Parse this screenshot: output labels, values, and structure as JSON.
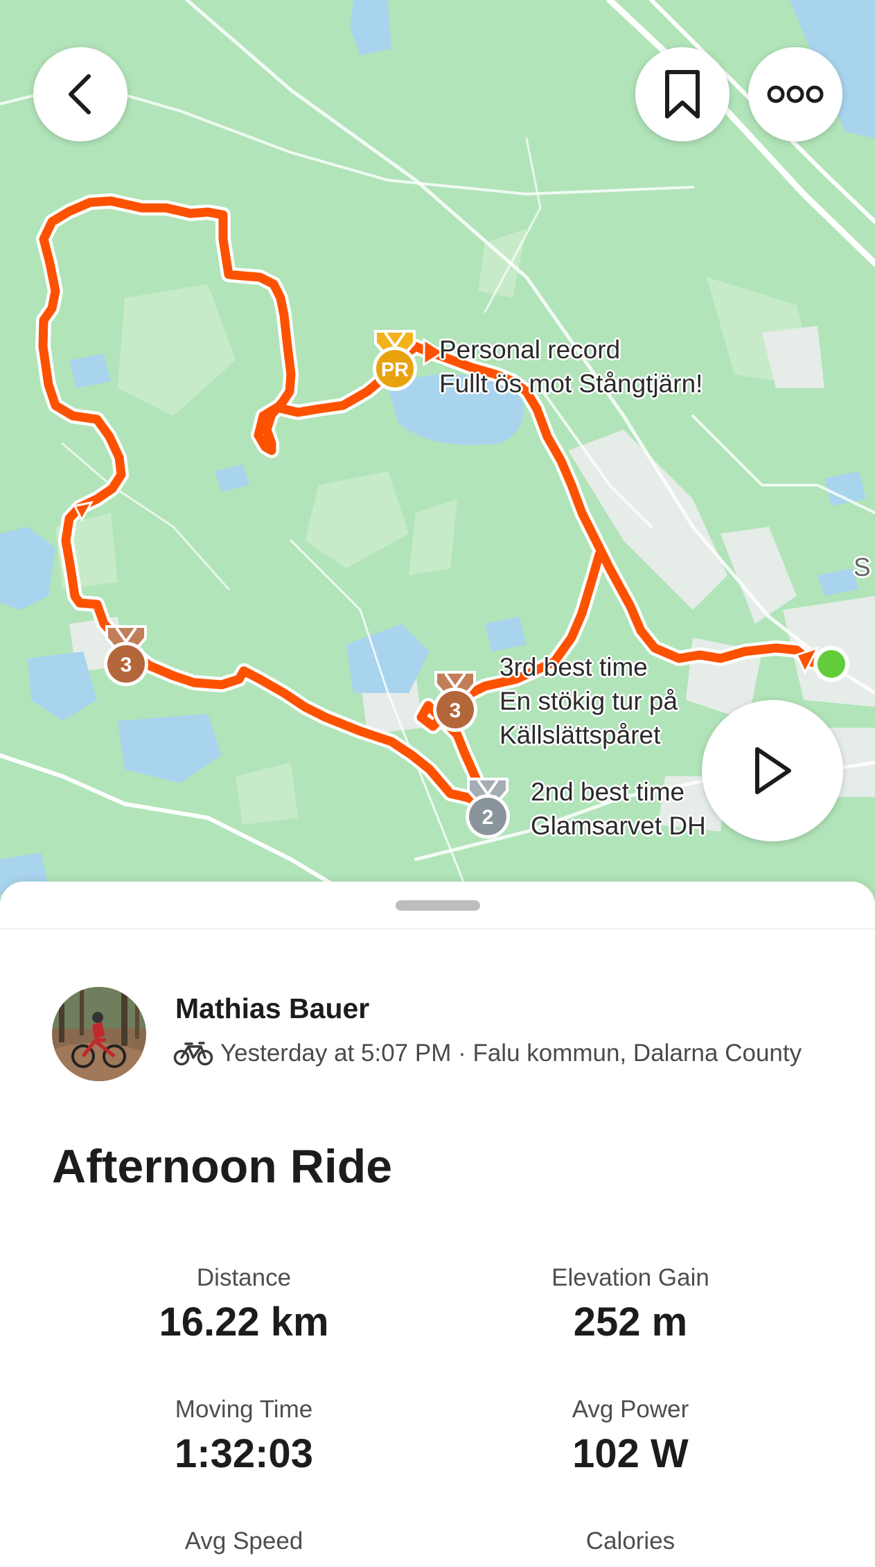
{
  "map": {
    "labels": {
      "pr": {
        "kind": "Personal record",
        "segment": "Fullt ös mot Stångtjärn!"
      },
      "third": {
        "kind": "3rd best time",
        "segment_line1": "En stökig tur på",
        "segment_line2": "Källslättspåret"
      },
      "second": {
        "kind": "2nd best time",
        "segment": "Glamsarvet DH"
      },
      "edge_letter": "S"
    },
    "medals": {
      "pr": "PR",
      "third_left": "3",
      "third_center": "3",
      "second": "2"
    },
    "colors": {
      "route": "#fc5200",
      "land": "#b0e4b8",
      "water": "#a7d3ee",
      "start_dot": "#62cc3a"
    }
  },
  "buttons": {
    "back_icon": "chevron-left-icon",
    "bookmark_icon": "bookmark-icon",
    "more_icon": "more-options-icon",
    "play_icon": "play-icon"
  },
  "athlete": {
    "name": "Mathias Bauer",
    "sport_icon": "bike-icon",
    "meta": "Yesterday at 5:07 PM · Falu kommun, Dalarna County"
  },
  "activity": {
    "title": "Afternoon Ride"
  },
  "stats": [
    {
      "label": "Distance",
      "value": "16.22 km"
    },
    {
      "label": "Elevation Gain",
      "value": "252 m"
    },
    {
      "label": "Moving Time",
      "value": "1:32:03"
    },
    {
      "label": "Avg Power",
      "value": "102 W"
    },
    {
      "label": "Avg Speed",
      "value": ""
    },
    {
      "label": "Calories",
      "value": ""
    }
  ]
}
